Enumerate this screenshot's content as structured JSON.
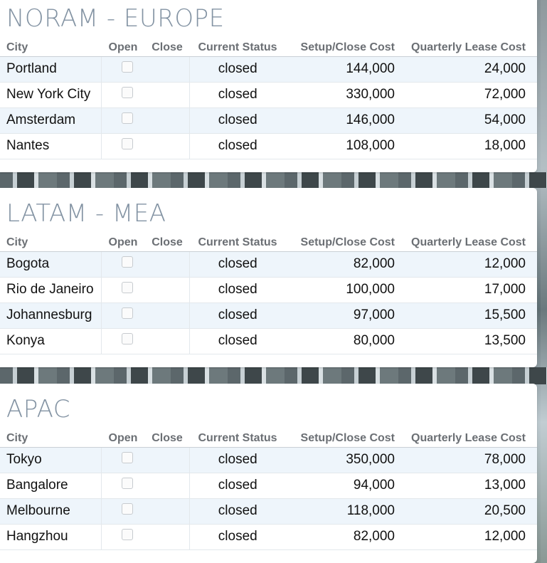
{
  "columns": {
    "city": "City",
    "open": "Open",
    "close": "Close",
    "status": "Current Status",
    "setup": "Setup/Close Cost",
    "lease": "Quarterly Lease Cost"
  },
  "regions": [
    {
      "title": "NORAM - EUROPE",
      "rows": [
        {
          "city": "Portland",
          "open": false,
          "status": "closed",
          "setup": "144,000",
          "lease": "24,000"
        },
        {
          "city": "New York City",
          "open": false,
          "status": "closed",
          "setup": "330,000",
          "lease": "72,000"
        },
        {
          "city": "Amsterdam",
          "open": false,
          "status": "closed",
          "setup": "146,000",
          "lease": "54,000"
        },
        {
          "city": "Nantes",
          "open": false,
          "status": "closed",
          "setup": "108,000",
          "lease": "18,000"
        }
      ]
    },
    {
      "title": "LATAM - MEA",
      "rows": [
        {
          "city": "Bogota",
          "open": false,
          "status": "closed",
          "setup": "82,000",
          "lease": "12,000"
        },
        {
          "city": "Rio de Janeiro",
          "open": false,
          "status": "closed",
          "setup": "100,000",
          "lease": "17,000"
        },
        {
          "city": "Johannesburg",
          "open": false,
          "status": "closed",
          "setup": "97,000",
          "lease": "15,500"
        },
        {
          "city": "Konya",
          "open": false,
          "status": "closed",
          "setup": "80,000",
          "lease": "13,500"
        }
      ]
    },
    {
      "title": "APAC",
      "rows": [
        {
          "city": "Tokyo",
          "open": false,
          "status": "closed",
          "setup": "350,000",
          "lease": "78,000"
        },
        {
          "city": "Bangalore",
          "open": false,
          "status": "closed",
          "setup": "94,000",
          "lease": "13,000"
        },
        {
          "city": "Melbourne",
          "open": false,
          "status": "closed",
          "setup": "118,000",
          "lease": "20,500"
        },
        {
          "city": "Hangzhou",
          "open": false,
          "status": "closed",
          "setup": "82,000",
          "lease": "12,000"
        }
      ]
    }
  ]
}
